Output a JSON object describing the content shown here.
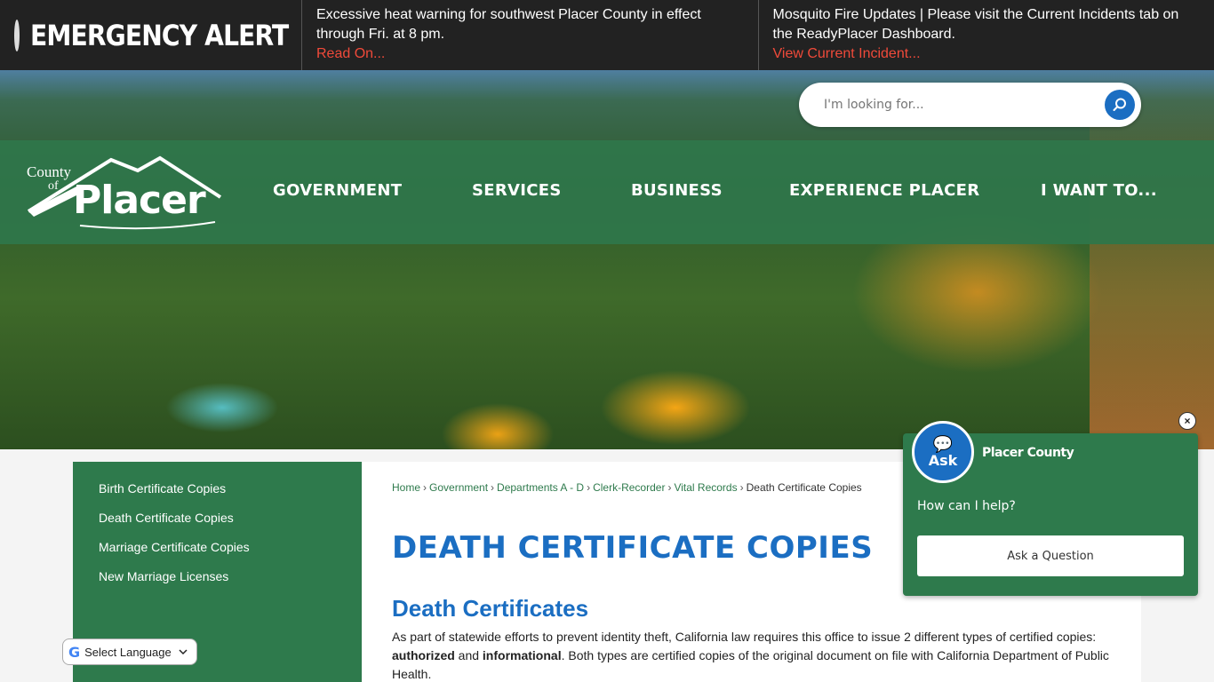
{
  "alert": {
    "label": "EMERGENCY ALERT",
    "items": [
      {
        "text": "Excessive heat warning for southwest Placer County in effect through Fri. at 8 pm.",
        "link": "Read On..."
      },
      {
        "text": "Mosquito Fire Updates | Please visit the Current Incidents tab on the ReadyPlacer Dashboard.",
        "link": "View Current Incident..."
      }
    ]
  },
  "search": {
    "placeholder": "I'm looking for..."
  },
  "logo": {
    "line1": "County",
    "line2": "of",
    "name": "Placer"
  },
  "nav": {
    "items": [
      "GOVERNMENT",
      "SERVICES",
      "BUSINESS",
      "EXPERIENCE PLACER",
      "I WANT TO..."
    ]
  },
  "sidebar": {
    "items": [
      "Birth Certificate Copies",
      "Death Certificate Copies",
      "Marriage Certificate Copies",
      "New Marriage Licenses"
    ]
  },
  "breadcrumb": {
    "items": [
      "Home",
      "Government",
      "Departments A - D",
      "Clerk-Recorder",
      "Vital Records"
    ],
    "current": "Death Certificate Copies",
    "separator": "›"
  },
  "page": {
    "title": "DEATH CERTIFICATE COPIES",
    "subtitle": "Death Certificates",
    "body_before": "As part of statewide efforts to prevent identity theft, California law requires this office to issue 2 different types of certified copies: ",
    "bold1": "authorized",
    "mid": " and ",
    "bold2": "informational",
    "body_after": ". Both types are certified copies of the original document on file with California Department of Public Health."
  },
  "language": {
    "label": "Select Language",
    "g": "G"
  },
  "chat": {
    "avatar_label": "Ask",
    "org": "Placer County",
    "prompt": "How can I help?",
    "button": "Ask a Question",
    "close": "×"
  },
  "colors": {
    "green": "#2e7a4c",
    "blue": "#1b6ec2",
    "alert_red": "#f04a3a"
  }
}
